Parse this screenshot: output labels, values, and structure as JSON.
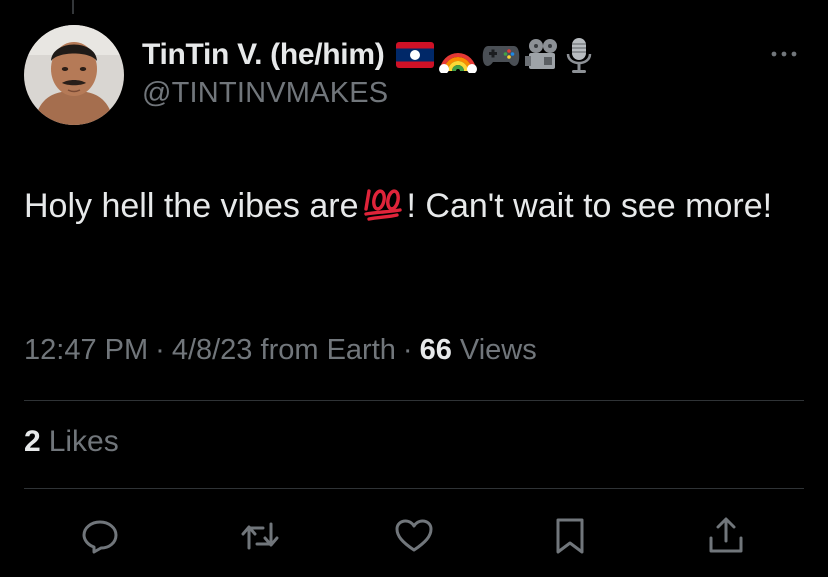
{
  "tweet": {
    "author": {
      "display_name": "TinTin V. (he/him)",
      "handle": "@TINTINVMAKES",
      "name_emojis": [
        "laos-flag-icon",
        "rainbow-icon",
        "game-controller-icon",
        "film-projector-icon",
        "microphone-icon"
      ]
    },
    "text": {
      "part1": "Holy hell the vibes are",
      "emoji": "hundred-points-icon",
      "part2": "! Can't wait to see more!"
    },
    "meta": {
      "time": "12:47 PM",
      "separator": "·",
      "date": "4/8/23",
      "source": "from Earth",
      "views_count": "66",
      "views_label": "Views"
    },
    "likes": {
      "count": "2",
      "label": "Likes"
    },
    "actions": [
      "reply-icon",
      "retweet-icon",
      "like-icon",
      "bookmark-icon",
      "share-icon"
    ]
  },
  "colors": {
    "background": "#000000",
    "text_primary": "#e7e9ea",
    "text_secondary": "#71767b",
    "divider": "#2f3336"
  }
}
